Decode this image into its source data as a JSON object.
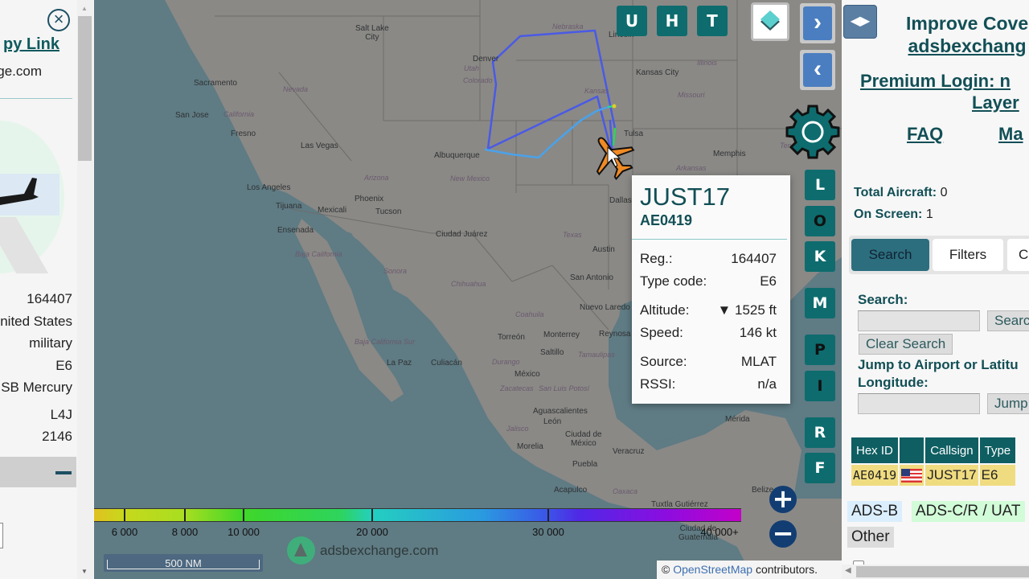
{
  "left_panel": {
    "close_icon": "×",
    "copy_link": "Copy Link",
    "copy_link_visible": "py Link",
    "domain": "ge.com",
    "info": {
      "registration": "164407",
      "country": "nited States",
      "category": "military",
      "type_code": "E6",
      "type_name": "SB Mercury",
      "icao_class": "L4J",
      "squawk": "2146"
    }
  },
  "map": {
    "top_buttons": [
      "U",
      "H",
      "T"
    ],
    "side_buttons": [
      "L",
      "O",
      "K",
      "M",
      "P",
      "I",
      "R",
      "F"
    ],
    "next_icon": "›",
    "prev_icon": "‹",
    "labels": {
      "cities": [
        {
          "name": "Salt Lake City",
          "text": "Salt Lake\nCity"
        },
        {
          "name": "Denver",
          "text": "Denver"
        },
        {
          "name": "Lincoln",
          "text": "Lincoln"
        },
        {
          "name": "Kansas City",
          "text": "Kansas City"
        },
        {
          "name": "Sacramento",
          "text": "Sacramento"
        },
        {
          "name": "San Jose",
          "text": "San Jose"
        },
        {
          "name": "Fresno",
          "text": "Fresno"
        },
        {
          "name": "Las Vegas",
          "text": "Las Vegas"
        },
        {
          "name": "Albuquerque",
          "text": "Albuquerque"
        },
        {
          "name": "Tulsa",
          "text": "Tulsa"
        },
        {
          "name": "Memphis",
          "text": "Memphis"
        },
        {
          "name": "Los Angeles",
          "text": "Los Angeles"
        },
        {
          "name": "Phoenix",
          "text": "Phoenix"
        },
        {
          "name": "Tijuana",
          "text": "Tijuana"
        },
        {
          "name": "Mexicali",
          "text": "Mexicali"
        },
        {
          "name": "Tucson",
          "text": "Tucson"
        },
        {
          "name": "Dallas",
          "text": "Dallas"
        },
        {
          "name": "Ensenada",
          "text": "Ensenada"
        },
        {
          "name": "Ciudad Juarez",
          "text": "Ciudad Juárez"
        },
        {
          "name": "Austin",
          "text": "Austin"
        },
        {
          "name": "San Antonio",
          "text": "San Antonio"
        },
        {
          "name": "Nuevo Laredo",
          "text": "Nuevo Laredo"
        },
        {
          "name": "Torreon",
          "text": "Torreón"
        },
        {
          "name": "Monterrey",
          "text": "Monterrey"
        },
        {
          "name": "Reynosa",
          "text": "Reynosa"
        },
        {
          "name": "Saltillo",
          "text": "Saltillo"
        },
        {
          "name": "La Paz",
          "text": "La Paz"
        },
        {
          "name": "Culiacan",
          "text": "Culiacán"
        },
        {
          "name": "Mexico",
          "text": "México"
        },
        {
          "name": "Aguascalientes",
          "text": "Aguascalientes"
        },
        {
          "name": "Leon",
          "text": "León"
        },
        {
          "name": "Morelia",
          "text": "Morelia"
        },
        {
          "name": "Ciudad de Mexico",
          "text": "Ciudad de\nMéxico"
        },
        {
          "name": "Puebla",
          "text": "Puebla"
        },
        {
          "name": "Veracruz",
          "text": "Veracruz"
        },
        {
          "name": "Merida",
          "text": "Mérida"
        },
        {
          "name": "Acapulco",
          "text": "Acapulco"
        },
        {
          "name": "Tuxtla Gutierrez",
          "text": "Tuxtla Gutiérrez"
        },
        {
          "name": "Ciudad de Guatemala",
          "text": "Ciudad de\nGuatemala"
        },
        {
          "name": "Belize",
          "text": "Belize"
        }
      ],
      "states": [
        "Nebraska",
        "Colorado",
        "Kansas",
        "Missouri",
        "Utah",
        "Nevada",
        "California",
        "Arizona",
        "New Mexico",
        "Texas",
        "Arkansas",
        "Illinois",
        "Baja California",
        "Sonora",
        "Chihuahua",
        "Coahuila",
        "Durango",
        "Baja California Sur",
        "Zacatecas",
        "San Luis Potosí",
        "Jalisco",
        "Tamaulipas",
        "Oaxaca",
        "Tennessee"
      ]
    },
    "popup": {
      "callsign": "JUST17",
      "hex": "AE0419",
      "rows": [
        {
          "label": "Reg.:",
          "value": "164407"
        },
        {
          "label": "Type code:",
          "value": "E6"
        },
        {
          "label": "Altitude:",
          "value": "▼ 1525 ft"
        },
        {
          "label": "Speed:",
          "value": "146 kt"
        },
        {
          "label": "Source:",
          "value": "MLAT"
        },
        {
          "label": "RSSI:",
          "value": "n/a"
        }
      ]
    },
    "altitude_legend": {
      "ticks": [
        "6 000",
        "8 000",
        "10 000",
        "20 000",
        "30 000",
        "40 000+"
      ]
    },
    "scale": "500 NM",
    "watermark": "adsbexchange.com",
    "zoom_in": "+",
    "zoom_out": "−",
    "attribution_prefix": "©",
    "attribution_link": "OpenStreetMap",
    "attribution_suffix": "contributors."
  },
  "right_panel": {
    "toggle_icon": "◀▶",
    "promo_line1": "Improve Cove",
    "promo_line2": "adsbexchang",
    "premium": "Premium Login: n",
    "premium_line2": "Layer",
    "faq": "FAQ",
    "map_link": "Ma",
    "total_aircraft_label": "Total Aircraft:",
    "total_aircraft": "0",
    "on_screen_label": "On Screen:",
    "on_screen": "1",
    "tabs": [
      "Search",
      "Filters",
      "C"
    ],
    "search_label": "Search:",
    "search_value": "",
    "search_button": "Searc",
    "clear_search": "Clear Search",
    "jump_label_1": "Jump to Airport or Latitu",
    "jump_label_2": "Longitude:",
    "jump_value": "",
    "jump_button": "Jump",
    "table": {
      "headers": [
        "Hex ID",
        "",
        "Callsign",
        "Type"
      ],
      "rows": [
        {
          "hex": "AE0419",
          "flag": "us-flag",
          "callsign": "JUST17",
          "type": "E6"
        }
      ]
    },
    "legend": {
      "adsb": "ADS-B",
      "adsc": "ADS-C/R / UAT",
      "other": "Other"
    },
    "colors": {
      "adsb": "#dbeefd",
      "adsc": "#d2fbd8",
      "other": "#dcdcdc",
      "brand": "#124f56",
      "selected_row": "#f0dc80"
    }
  }
}
